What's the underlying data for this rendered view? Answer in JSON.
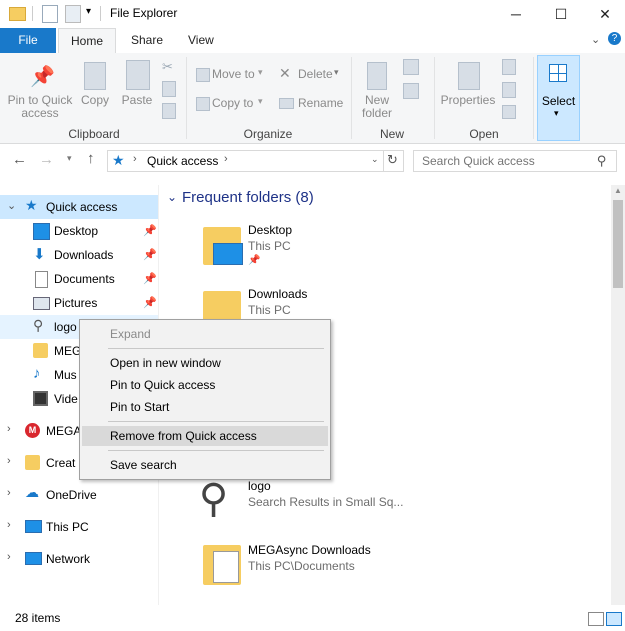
{
  "window": {
    "title": "File Explorer",
    "minimize": "─",
    "maximize": "☐",
    "close": "✕"
  },
  "ribbon_tabs": {
    "file": "File",
    "home": "Home",
    "share": "Share",
    "view": "View",
    "help": "?",
    "collapse": "⌄"
  },
  "ribbon": {
    "clipboard": {
      "pin": "Pin to Quick access",
      "copy": "Copy",
      "paste": "Paste",
      "group": "Clipboard"
    },
    "organize": {
      "move_to": "Move to",
      "copy_to": "Copy to",
      "delete": "Delete",
      "rename": "Rename",
      "group": "Organize"
    },
    "new": {
      "new_folder": "New folder",
      "group": "New"
    },
    "open": {
      "properties": "Properties",
      "group": "Open"
    },
    "select": {
      "label": "Select"
    }
  },
  "address": {
    "breadcrumb": "Quick access",
    "search_placeholder": "Search Quick access"
  },
  "nav": {
    "quick_access": "Quick access",
    "desktop": "Desktop",
    "downloads": "Downloads",
    "documents": "Documents",
    "pictures": "Pictures",
    "logo": "logo",
    "mega": "MEG",
    "music": "Mus",
    "videos": "Vide",
    "megasync": "MEGA",
    "creative": "Creat",
    "onedrive": "OneDrive",
    "thispc": "This PC",
    "network": "Network"
  },
  "content": {
    "header": "Frequent folders (8)",
    "items": [
      {
        "name": "Desktop",
        "sub": "This PC"
      },
      {
        "name": "Downloads",
        "sub": "This PC"
      },
      {
        "name": "logo",
        "sub": "Search Results in Small Sq..."
      },
      {
        "name": "MEGAsync Downloads",
        "sub": "This PC\\Documents"
      }
    ]
  },
  "context_menu": {
    "expand": "Expand",
    "open_new_window": "Open in new window",
    "pin_quick": "Pin to Quick access",
    "pin_start": "Pin to Start",
    "remove_quick": "Remove from Quick access",
    "save_search": "Save search"
  },
  "status": {
    "items": "28 items"
  },
  "colors": {
    "accent": "#1979ca",
    "folder": "#f6cd61",
    "selected": "#cce8ff"
  }
}
